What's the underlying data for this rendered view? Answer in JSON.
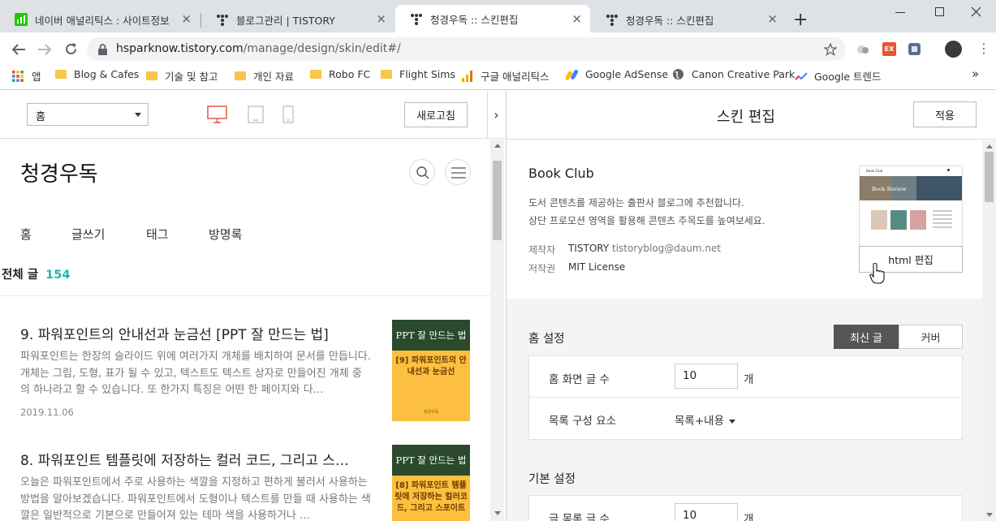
{
  "browser": {
    "tabs": [
      {
        "title": "네이버 애널리틱스 : 사이트정보",
        "close": "×"
      },
      {
        "title": "블로그관리 | TISTORY",
        "close": "×"
      },
      {
        "title": "청경우독 :: 스킨편집",
        "close": "×"
      },
      {
        "title": "청경우독 :: 스킨편집",
        "close": "×"
      }
    ],
    "new_tab": "+",
    "url_host": "hsparknow.tistory.com",
    "url_path": "/manage/design/skin/edit#/",
    "bookmarks": [
      {
        "label": "앱",
        "icon": "apps-grid-icon"
      },
      {
        "label": "Blog & Cafes",
        "icon": "folder-icon"
      },
      {
        "label": "기술 및 참고",
        "icon": "folder-icon"
      },
      {
        "label": "개인 자료",
        "icon": "folder-icon"
      },
      {
        "label": "Robo FC",
        "icon": "folder-icon"
      },
      {
        "label": "Flight Sims",
        "icon": "folder-icon"
      },
      {
        "label": "구글 애널리틱스",
        "icon": "analytics-icon"
      },
      {
        "label": "Google AdSense",
        "icon": "adsense-icon"
      },
      {
        "label": "Canon Creative Park",
        "icon": "globe-icon"
      },
      {
        "label": "Google 트렌드",
        "icon": "trends-icon"
      }
    ],
    "bookmarks_more": "»",
    "ext_badge": "EX"
  },
  "preview": {
    "select_value": "홈",
    "refresh_label": "새로고침",
    "collapse": "›",
    "blog_title": "청경우독",
    "nav": [
      "홈",
      "글쓰기",
      "태그",
      "방명록"
    ],
    "count_label": "전체 글",
    "count_value": "154",
    "posts": [
      {
        "title": "9. 파워포인트의 안내선과 눈금선 [PPT 잘 만드는 법]",
        "excerpt": "파워포인트는 한장의 슬라이드 위에 여러가지 개체를 배치하여 문서를 만듭니다. 개체는 그림, 도형, 표가 될 수 있고, 텍스트도 텍스트 상자로 만들어진 개체 중의 하나라고 할 수 있습니다. 또 한가지 특징은 어떤 한 페이지와 다…",
        "date": "2019.11.06",
        "thumb_top": "PPT 잘 만드는 법",
        "thumb_bottom": "[9] 파워포인트의 안내선과 눈금선",
        "thumb_brand": "청경우독"
      },
      {
        "title": "8. 파워포인트 템플릿에 저장하는 컬러 코드, 그리고 스…",
        "excerpt": "오늘은 파워포인트에서 주로 사용하는 색깔을 지정하고 편하게 불러서 사용하는 방법을 알아보겠습니다. 파워포인트에서 도형이나 텍스트를 만들 때 사용하는 색깔은 일반적으로 기본으로 만들어져 있는 테마 색을 사용하거나 …",
        "thumb_top": "PPT 잘 만드는 법",
        "thumb_bottom": "[8] 파워포인트 템플릿에 저장하는 컬러코드, 그리고 스포이트"
      }
    ]
  },
  "editor": {
    "title": "스킨 편집",
    "apply_label": "적용",
    "skin_name": "Book Club",
    "skin_desc_1": "도서 콘텐츠를 제공하는 출판사 블로그에 추천합니다.",
    "skin_desc_2": "상단 프로모션 영역을 활용해 콘텐츠 주목도를 높여보세요.",
    "maker_label": "제작자",
    "maker_name": "TISTORY",
    "maker_email": "tistoryblog@daum.net",
    "license_label": "저작권",
    "license_value": "MIT License",
    "thumb_logo": "Book Club",
    "thumb_banner": "Book Review",
    "html_edit_label": "html 편집",
    "home_section": "홈 설정",
    "home_tabs": [
      "최신 글",
      "커버"
    ],
    "home_count_label": "홈 화면 글 수",
    "home_count_value": "10",
    "unit": "개",
    "list_comp_label": "목록 구성 요소",
    "list_comp_value": "목록+내용",
    "basic_section": "기본 설정",
    "list_count_label": "글 목록 글 수",
    "list_count_value": "10"
  },
  "colors": {
    "accent_teal": "#1fb5ad",
    "device_red": "#e34b3f",
    "tab_dark": "#555555",
    "thumb_green": "#2b4a2d",
    "thumb_yellow": "#fcbf3f"
  }
}
